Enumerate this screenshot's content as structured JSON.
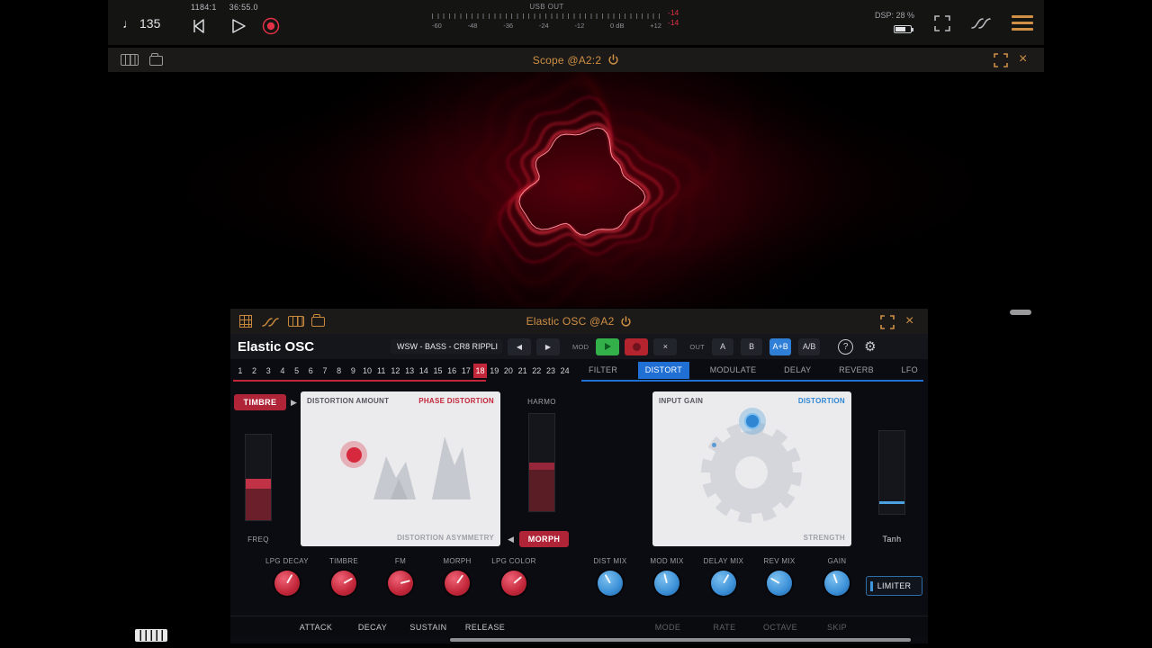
{
  "topbar": {
    "tempo": "135",
    "position_bars": "1184:1",
    "position_time": "36:55.0",
    "usb_out_label": "USB OUT",
    "meter_scale": [
      "-60",
      "-48",
      "-36",
      "-24",
      "-12",
      "0 dB",
      "+12"
    ],
    "peak_values": [
      "-14",
      "-14"
    ],
    "dsp_label": "DSP: 28 %"
  },
  "scope": {
    "title": "Scope @A2:2"
  },
  "plugin": {
    "window_title": "Elastic OSC @A2",
    "name": "Elastic OSC",
    "preset": "WSW - BASS - CR8 RIPPLI",
    "mod_label": "MOD",
    "out_label": "OUT",
    "out_buttons": [
      {
        "label": "A",
        "active": false
      },
      {
        "label": "B",
        "active": false
      },
      {
        "label": "A+B",
        "active": true
      },
      {
        "label": "A/B",
        "active": false
      }
    ],
    "steps": [
      "1",
      "2",
      "3",
      "4",
      "5",
      "6",
      "7",
      "8",
      "9",
      "10",
      "11",
      "12",
      "13",
      "14",
      "15",
      "16",
      "17",
      "18",
      "19",
      "20",
      "21",
      "22",
      "23",
      "24"
    ],
    "active_step": "18",
    "tabs": [
      {
        "label": "FILTER",
        "active": false
      },
      {
        "label": "DISTORT",
        "active": true
      },
      {
        "label": "MODULATE",
        "active": false
      },
      {
        "label": "DELAY",
        "active": false
      },
      {
        "label": "REVERB",
        "active": false
      },
      {
        "label": "LFO",
        "active": false
      }
    ],
    "timbre_button": "TIMBRE",
    "morph_button": "MORPH",
    "freq_label": "FREQ",
    "harmo_label": "HARMO",
    "tanh_label": "Tanh",
    "pad1": {
      "top_left": "DISTORTION AMOUNT",
      "top_right": "PHASE DISTORTION",
      "bottom_right": "DISTORTION ASYMMETRY"
    },
    "pad2": {
      "top_left": "INPUT GAIN",
      "top_right": "DISTORTION",
      "bottom_right": "STRENGTH"
    },
    "knobs": [
      {
        "label": "LPG DECAY",
        "color": "red",
        "deg": 210
      },
      {
        "label": "TIMBRE",
        "color": "red",
        "deg": 240
      },
      {
        "label": "FM",
        "color": "red",
        "deg": 255
      },
      {
        "label": "MORPH",
        "color": "red",
        "deg": 215
      },
      {
        "label": "LPG COLOR",
        "color": "red",
        "deg": 230
      },
      {
        "label": "DIST MIX",
        "color": "blue",
        "deg": 150
      },
      {
        "label": "MOD MIX",
        "color": "blue",
        "deg": 165
      },
      {
        "label": "DELAY MIX",
        "color": "blue",
        "deg": 210
      },
      {
        "label": "REV MIX",
        "color": "blue",
        "deg": 120
      },
      {
        "label": "GAIN",
        "color": "blue",
        "deg": 160
      }
    ],
    "limiter_label": "LIMITER",
    "env_labels": [
      "ATTACK",
      "DECAY",
      "SUSTAIN",
      "RELEASE"
    ],
    "seq_labels": [
      "MODE",
      "RATE",
      "OCTAVE",
      "SKIP"
    ]
  },
  "colors": {
    "accent_orange": "#cf8f45",
    "accent_red": "#c22639",
    "accent_blue": "#2f7fd6",
    "scope_trace": "#ff3448"
  }
}
